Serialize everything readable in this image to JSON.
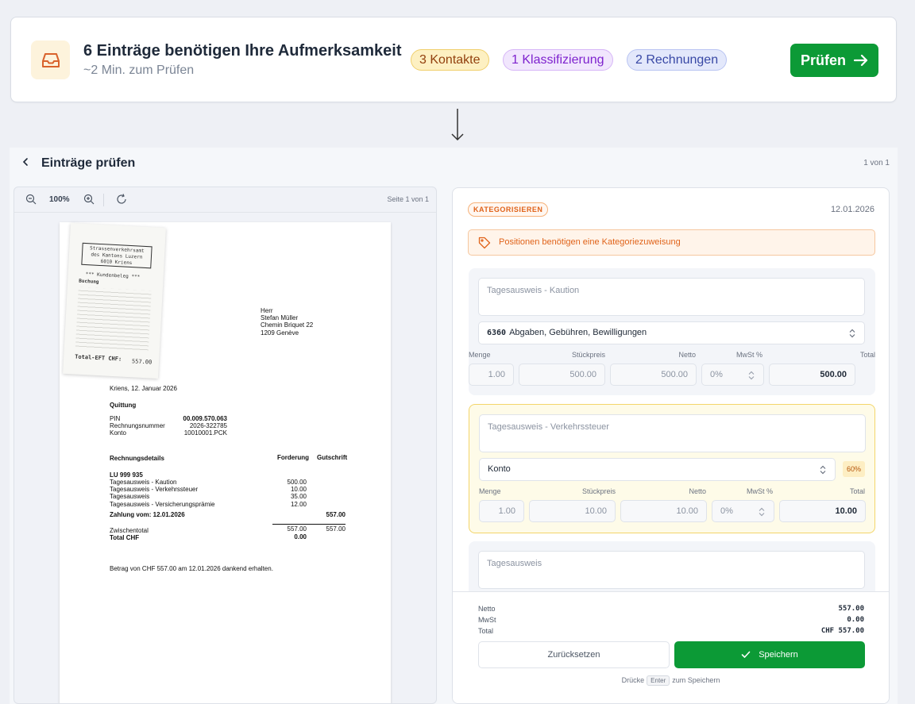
{
  "banner": {
    "icon": "inbox-icon",
    "title": "6 Einträge benötigen Ihre Aufmerksamkeit",
    "subtitle": "~2 Min. zum Prüfen",
    "pills": [
      "3 Kontakte",
      "1 Klassifizierung",
      "2 Rechnungen"
    ],
    "button_label": "Prüfen",
    "accent": "#0c9a36"
  },
  "review": {
    "title": "Einträge prüfen",
    "counter": "1 von 1"
  },
  "viewer": {
    "zoom": "100%",
    "page": "Seite 1 von 1"
  },
  "document": {
    "receipt": {
      "office": [
        "Strassenverkehrsamt",
        "des Kantons Luzern",
        "6010 Kriens"
      ],
      "heading": "*** Kundenbeleg ***",
      "type": "Buchung",
      "amount_line": "Total-EFT CHF:",
      "amount": "557.00"
    },
    "recipient": [
      "Herr",
      "Stefan Müller",
      "Chemin Briquet 22",
      "1209 Genève"
    ],
    "place_date": "Kriens, 12. Januar 2026",
    "quittung": "Quittung",
    "meta": [
      {
        "label": "PIN",
        "value": "00.009.570.063"
      },
      {
        "label": "Rechnungsnummer",
        "value": "2026-322785"
      },
      {
        "label": "Konto",
        "value": "10010001.PCK"
      }
    ],
    "details_heading": "Rechnungsdetails",
    "col_forderung": "Forderung",
    "col_gutschrift": "Gutschrift",
    "plate": "LU 999 935",
    "lines": [
      {
        "label": "Tagesausweis - Kaution",
        "value": "500.00"
      },
      {
        "label": "Tagesausweis - Verkehrssteuer",
        "value": "10.00"
      },
      {
        "label": "Tagesausweis",
        "value": "35.00"
      },
      {
        "label": "Tagesausweis - Versicherungsprämie",
        "value": "12.00"
      }
    ],
    "payment": "Zahlung vom: 12.01.2026",
    "payment_value": "557.00",
    "subtotal_label": "Zwischentotal",
    "subtotal_f": "557.00",
    "subtotal_g": "557.00",
    "total_label": "Total CHF",
    "total_value": "0.00",
    "footer": "Betrag von CHF 557.00 am 12.01.2026 dankend erhalten."
  },
  "editor": {
    "badge": "KATEGORISIEREN",
    "date": "12.01.2026",
    "warning": "Positionen benötigen eine Kategoriezuweisung",
    "col_labels": {
      "menge": "Menge",
      "stueckpreis": "Stückpreis",
      "netto": "Netto",
      "mwst": "MwSt %",
      "total": "Total"
    },
    "items": [
      {
        "desc": "Tagesausweis - Kaution",
        "account_code": "6360",
        "account": "Abgaben, Gebühren, Bewilligungen",
        "menge": "1.00",
        "preis": "500.00",
        "netto": "500.00",
        "mwst": "0%",
        "total": "500.00"
      },
      {
        "desc": "Tagesausweis - Verkehrssteuer",
        "account_placeholder": "Konto",
        "confidence": "60%",
        "menge": "1.00",
        "preis": "10.00",
        "netto": "10.00",
        "mwst": "0%",
        "total": "10.00"
      },
      {
        "desc": "Tagesausweis"
      }
    ],
    "totals": [
      {
        "label": "Netto",
        "value": "557.00"
      },
      {
        "label": "MwSt",
        "value": "0.00"
      },
      {
        "label": "Total",
        "value": "CHF 557.00"
      }
    ],
    "reset_label": "Zurücksetzen",
    "save_label": "Speichern",
    "hint_pre": "Drücke",
    "hint_key": "Enter",
    "hint_post": "zum Speichern",
    "highlight_color": "#f3d56a",
    "warning_color": "#e0631a"
  }
}
